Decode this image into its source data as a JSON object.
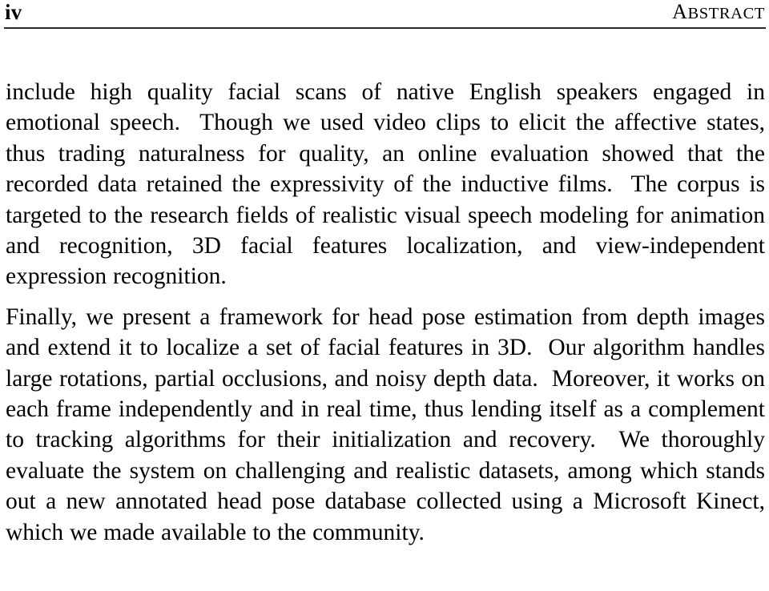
{
  "document": {
    "type": "thesis-abstract-page",
    "background_color": "#ffffff",
    "text_color": "#000000",
    "rule_color": "#2a2a2a"
  },
  "header": {
    "folio": "iv",
    "title_full": "Abstract",
    "title_initial": "A",
    "title_smallcaps": "BSTRACT",
    "rule_visible": true
  },
  "body": {
    "paragraphs": [
      {
        "id": "paragraph-1",
        "text": "include high quality facial scans of native English speakers engaged in emotional speech. Though we used video clips to elicit the affective states, thus trading naturalness for quality, an online evaluation showed that the recorded data retained the expressivity of the inductive films. The corpus is targeted to the research fields of realistic visual speech modeling for animation and recognition, 3D facial features localization, and view-independent expression recognition.",
        "lines": [
          "include high quality facial scans of native English speakers engaged in",
          "emotional speech.  Though we used video clips to elicit the affective",
          "states, thus trading naturalness for quality, an online evaluation showed",
          "that the recorded data retained the expressivity of the inductive films.",
          "The corpus is targeted to the research fields of realistic visual speech",
          "modeling for animation and recognition, 3D facial features localization,",
          "and view-independent expression recognition."
        ]
      },
      {
        "id": "paragraph-2",
        "text": "Finally, we present a framework for head pose estimation from depth images and extend it to localize a set of facial features in 3D. Our algorithm handles large rotations, partial occlusions, and noisy depth data. Moreover, it works on each frame independently and in real time, thus lending itself as a complement to tracking algorithms for their initialization and recovery. We thoroughly evaluate the system on challenging and realistic datasets, among which stands out a new annotated head pose database collected using a Microsoft Kinect, which we made available to the community.",
        "lines": [
          "Finally, we present a framework for head pose estimation from depth",
          "images and extend it to localize a set of facial features in 3D. Our algo-",
          "rithm handles large rotations, partial occlusions, and noisy depth data.",
          "Moreover, it works on each frame independently and in real time, thus",
          "lending itself as a complement to tracking algorithms for their initializa-",
          "tion and recovery.  We thoroughly evaluate the system on challenging and",
          "realistic datasets, among which stands out a new annotated head pose",
          "database collected using a Microsoft Kinect, which we made available to",
          "the community."
        ]
      }
    ]
  }
}
